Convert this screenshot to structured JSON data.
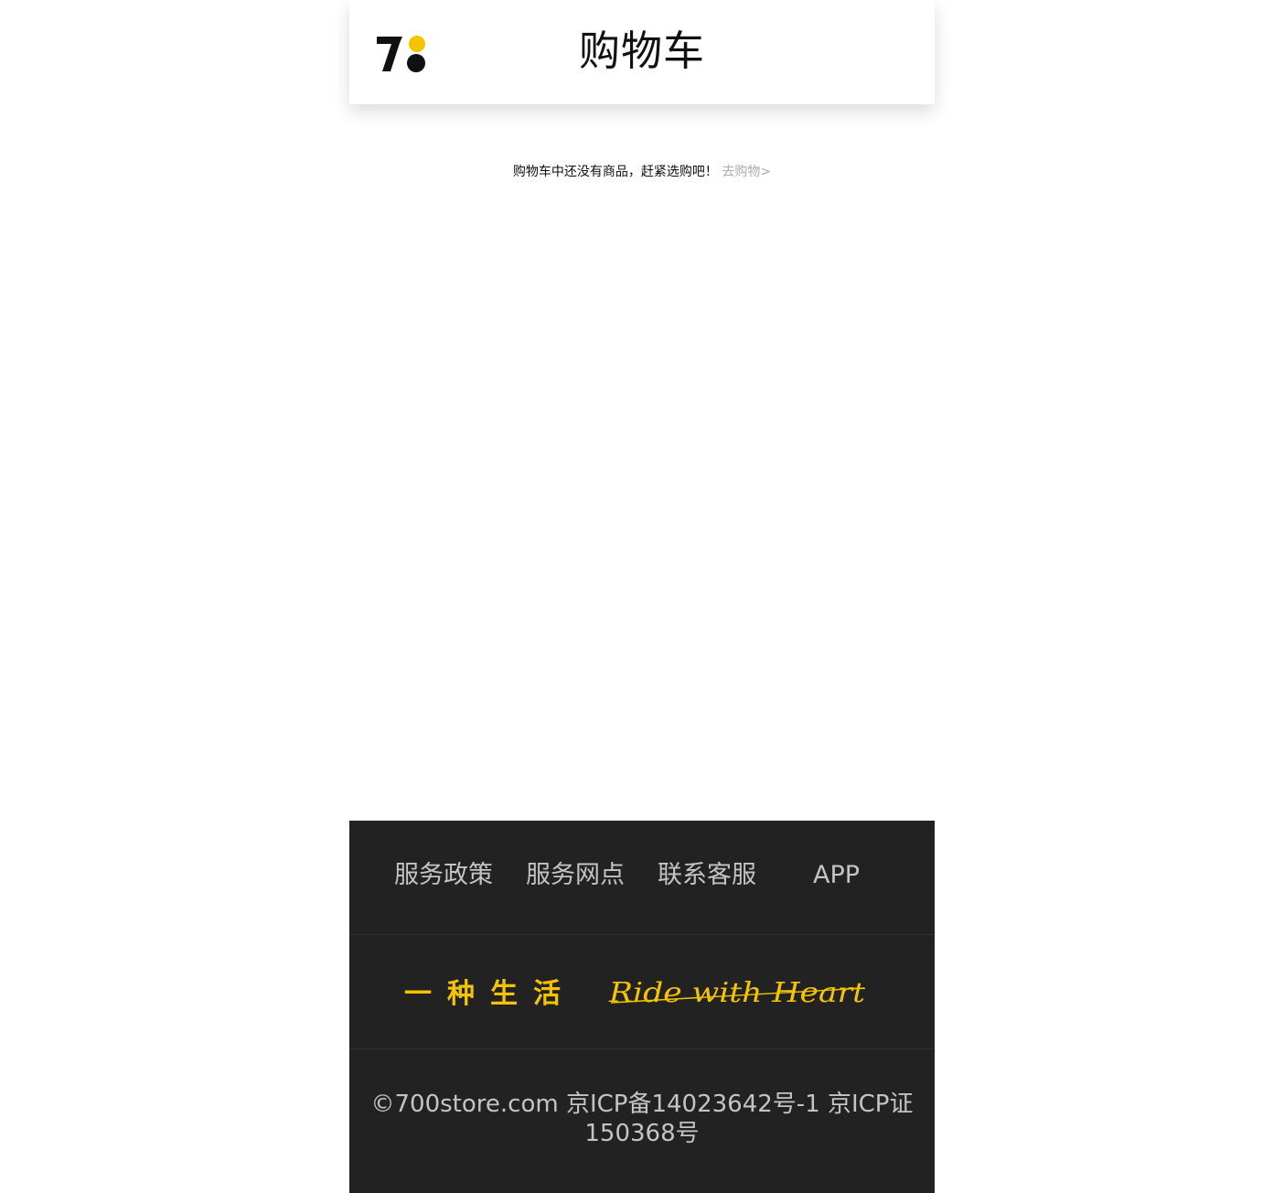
{
  "header": {
    "logo_alt": "7",
    "title": "购物车"
  },
  "cart": {
    "empty_message": "购物车中还没有商品，赶紧选购吧！",
    "shop_link": "去购物>"
  },
  "footer": {
    "nav": [
      {
        "label": "服务政策"
      },
      {
        "label": "服务网点"
      },
      {
        "label": "联系客服"
      },
      {
        "label": "APP"
      }
    ],
    "slogan_cn": "一种生活",
    "slogan_en": "Ride with Heart",
    "copyright": "©700store.com 京ICP备14023642号-1 京ICP证150368号"
  },
  "colors": {
    "accent_yellow": "#f5c400",
    "footer_bg": "#222222",
    "footer_text": "#c4c4c4",
    "link_gray": "#aaaaaa"
  }
}
